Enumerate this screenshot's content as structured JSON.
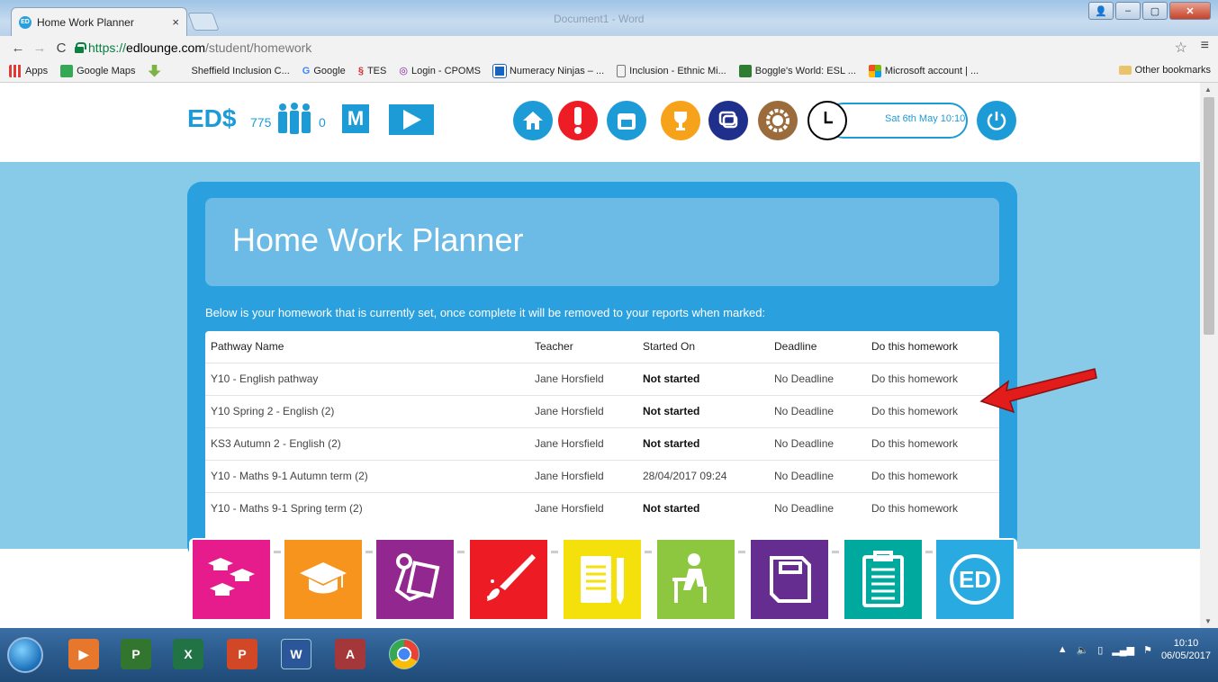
{
  "browser": {
    "tab_title": "Home Work Planner",
    "tab_close": "×",
    "ghost_title": "Document1 - Word",
    "url_scheme": "https://",
    "url_host": "edlounge.com",
    "url_path": "/student/homework",
    "bookmarks": [
      {
        "label": "Apps",
        "color": "#e53935"
      },
      {
        "label": "Google Maps",
        "color": "#34a853"
      },
      {
        "label": "",
        "color": "#7cb342"
      },
      {
        "label": "Sheffield Inclusion C...",
        "color": "#ffffff"
      },
      {
        "label": "Google",
        "color": "#4285f4"
      },
      {
        "label": "TES",
        "color": "#d32f2f"
      },
      {
        "label": "Login - CPOMS",
        "color": "#7b1fa2"
      },
      {
        "label": "Numeracy Ninjas – ...",
        "color": "#1565c0"
      },
      {
        "label": "Inclusion - Ethnic Mi...",
        "color": "#ffffff"
      },
      {
        "label": "Boggle's World: ESL ...",
        "color": "#2e7d32"
      },
      {
        "label": "Microsoft account | ...",
        "color": "#f25022"
      }
    ],
    "other_bookmarks": "Other bookmarks"
  },
  "header": {
    "eds_logo": "ED$",
    "eds_value": "775",
    "people_value": "0",
    "m_label": "M",
    "clock_text": "Sat 6th May 10:10"
  },
  "planner": {
    "title": "Home Work Planner",
    "intro": "Below is your homework that is currently set, once complete it will be removed to your reports when marked:",
    "columns": [
      "Pathway Name",
      "Teacher",
      "Started On",
      "Deadline",
      "Do this homework"
    ],
    "rows": [
      {
        "pathway": "Y10 - English pathway",
        "teacher": "Jane Horsfield",
        "started": "Not started",
        "deadline": "No Deadline",
        "action": "Do this homework"
      },
      {
        "pathway": "Y10 Spring 2 - English (2)",
        "teacher": "Jane Horsfield",
        "started": "Not started",
        "deadline": "No Deadline",
        "action": "Do this homework"
      },
      {
        "pathway": "KS3 Autumn 2 - English (2)",
        "teacher": "Jane Horsfield",
        "started": "Not started",
        "deadline": "No Deadline",
        "action": "Do this homework"
      },
      {
        "pathway": "Y10 - Maths 9-1 Autumn term (2)",
        "teacher": "Jane Horsfield",
        "started": "28/04/2017 09:24",
        "deadline": "No Deadline",
        "action": "Do this homework"
      },
      {
        "pathway": "Y10 - Maths 9-1 Spring term (2)",
        "teacher": "Jane Horsfield",
        "started": "Not started",
        "deadline": "No Deadline",
        "action": "Do this homework"
      }
    ]
  },
  "tiles": [
    {
      "name": "graduates-tile",
      "color": "#e61c8c"
    },
    {
      "name": "mortarboard-tile",
      "color": "#f7941d"
    },
    {
      "name": "reader-tile",
      "color": "#92278f"
    },
    {
      "name": "paintbrush-tile",
      "color": "#ed1c24"
    },
    {
      "name": "notepad-tile",
      "color": "#f4e10b"
    },
    {
      "name": "desk-student-tile",
      "color": "#8dc63f"
    },
    {
      "name": "book-tile",
      "color": "#662d91"
    },
    {
      "name": "clipboard-tile",
      "color": "#00a99d"
    },
    {
      "name": "ed-logo-tile",
      "color": "#29abe2"
    }
  ],
  "taskbar": {
    "apps": [
      {
        "name": "media-player",
        "label": "▶",
        "color": "#e8772e"
      },
      {
        "name": "project",
        "label": "P",
        "color": "#31752f"
      },
      {
        "name": "excel",
        "label": "X",
        "color": "#217346"
      },
      {
        "name": "powerpoint",
        "label": "P",
        "color": "#d24726"
      },
      {
        "name": "word",
        "label": "W",
        "color": "#2b579a"
      },
      {
        "name": "access",
        "label": "A",
        "color": "#a4373a"
      },
      {
        "name": "chrome",
        "label": "",
        "color": "#ffffff"
      }
    ],
    "time": "10:10",
    "date": "06/05/2017"
  }
}
